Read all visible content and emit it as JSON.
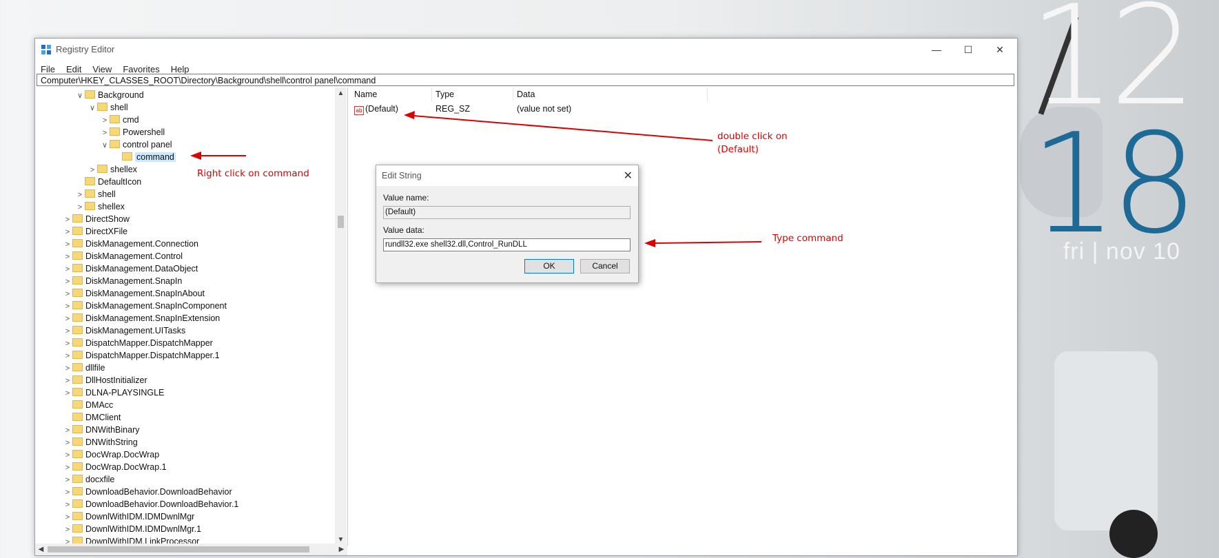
{
  "desktop": {
    "clock_hour": "12",
    "clock_minute": "18",
    "clock_date": "fri | nov 10"
  },
  "window": {
    "title": "Registry Editor",
    "controls": {
      "minimize": "—",
      "maximize": "☐",
      "close": "✕"
    },
    "menu": [
      "File",
      "Edit",
      "View",
      "Favorites",
      "Help"
    ],
    "address": "Computer\\HKEY_CLASSES_ROOT\\Directory\\Background\\shell\\control panel\\command"
  },
  "tree": [
    {
      "label": "Background",
      "exp": "∨"
    },
    {
      "label": "shell",
      "exp": "∨"
    },
    {
      "label": "cmd",
      "exp": ">"
    },
    {
      "label": "Powershell",
      "exp": ">"
    },
    {
      "label": "control panel",
      "exp": "∨"
    },
    {
      "label": "command",
      "exp": "",
      "selected": true
    },
    {
      "label": "shellex",
      "exp": ">"
    },
    {
      "label": "DefaultIcon",
      "exp": ""
    },
    {
      "label": "shell",
      "exp": ">"
    },
    {
      "label": "shellex",
      "exp": ">"
    },
    {
      "label": "DirectShow",
      "exp": ">"
    },
    {
      "label": "DirectXFile",
      "exp": ">"
    },
    {
      "label": "DiskManagement.Connection",
      "exp": ">"
    },
    {
      "label": "DiskManagement.Control",
      "exp": ">"
    },
    {
      "label": "DiskManagement.DataObject",
      "exp": ">"
    },
    {
      "label": "DiskManagement.SnapIn",
      "exp": ">"
    },
    {
      "label": "DiskManagement.SnapInAbout",
      "exp": ">"
    },
    {
      "label": "DiskManagement.SnapInComponent",
      "exp": ">"
    },
    {
      "label": "DiskManagement.SnapInExtension",
      "exp": ">"
    },
    {
      "label": "DiskManagement.UITasks",
      "exp": ">"
    },
    {
      "label": "DispatchMapper.DispatchMapper",
      "exp": ">"
    },
    {
      "label": "DispatchMapper.DispatchMapper.1",
      "exp": ">"
    },
    {
      "label": "dllfile",
      "exp": ">"
    },
    {
      "label": "DllHostInitializer",
      "exp": ">"
    },
    {
      "label": "DLNA-PLAYSINGLE",
      "exp": ">"
    },
    {
      "label": "DMAcc",
      "exp": ""
    },
    {
      "label": "DMClient",
      "exp": ""
    },
    {
      "label": "DNWithBinary",
      "exp": ">"
    },
    {
      "label": "DNWithString",
      "exp": ">"
    },
    {
      "label": "DocWrap.DocWrap",
      "exp": ">"
    },
    {
      "label": "DocWrap.DocWrap.1",
      "exp": ">"
    },
    {
      "label": "docxfile",
      "exp": ">"
    },
    {
      "label": "DownloadBehavior.DownloadBehavior",
      "exp": ">"
    },
    {
      "label": "DownloadBehavior.DownloadBehavior.1",
      "exp": ">"
    },
    {
      "label": "DownlWithIDM.IDMDwnlMgr",
      "exp": ">"
    },
    {
      "label": "DownlWithIDM.IDMDwnlMgr.1",
      "exp": ">"
    },
    {
      "label": "DownlWithIDM.LinkProcessor",
      "exp": ">"
    }
  ],
  "list": {
    "headers": {
      "name": "Name",
      "type": "Type",
      "data": "Data"
    },
    "rows": [
      {
        "icon": "ab",
        "name": "(Default)",
        "type": "REG_SZ",
        "data": "(value not set)"
      }
    ]
  },
  "dialog": {
    "title": "Edit String",
    "close": "✕",
    "value_name_label": "Value name:",
    "value_name": "(Default)",
    "value_data_label": "Value data:",
    "value_data": "rundll32.exe shell32.dll,Control_RunDLL",
    "ok": "OK",
    "cancel": "Cancel"
  },
  "annotations": {
    "right_click": "Right click on command",
    "double_click_line1": "double click on",
    "double_click_line2": "(Default)",
    "type_command": "Type command",
    "color": "#dd0000"
  }
}
